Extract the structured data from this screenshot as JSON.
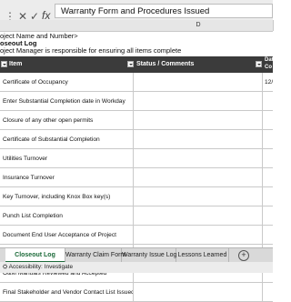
{
  "formula_bar": {
    "cancel_symbol": "✕",
    "confirm_symbol": "✓",
    "fx_label": "fx",
    "content": "Warranty Form and Procedures Issued"
  },
  "column_headers": {
    "d": "D"
  },
  "header_lines": {
    "project": "oject Name and Number>",
    "log_title": "oseout Log",
    "responsibility": "oject Manager is responsible for ensuring all items complete"
  },
  "table": {
    "col_item": "Item",
    "col_status": "Status / Comments",
    "col_date_partial": "Dat\nCo",
    "rows": [
      {
        "item": "Certificate of Occupancy",
        "date": "12/"
      },
      {
        "item": "Enter Substantial Completion date in Workday",
        "date": ""
      },
      {
        "item": "Closure of any other open permits",
        "date": ""
      },
      {
        "item": "Certificate of Substantial Completion",
        "date": ""
      },
      {
        "item": "Utilities Turnover",
        "date": ""
      },
      {
        "item": "Insurance Turnover",
        "date": ""
      },
      {
        "item": "Key Turnover, including Knox Box key(s)",
        "date": ""
      },
      {
        "item": "Punch List Completion",
        "date": ""
      },
      {
        "item": "Document End User Acceptance of Project",
        "date": ""
      },
      {
        "item": "As-Builts Reviewed and Accepted",
        "date": ""
      },
      {
        "item": "O&M Manuals Reviewed and Accepted",
        "date": ""
      },
      {
        "item": "Final Stakeholder and Vendor Contact List Issued",
        "date": ""
      }
    ]
  },
  "tabs": [
    {
      "label": "Closeout Log",
      "active": true
    },
    {
      "label": "Warranty Claim Form",
      "active": false
    },
    {
      "label": "Warranty Issue Log",
      "active": false
    },
    {
      "label": "Lessons Learned",
      "active": false
    }
  ],
  "add_sheet_symbol": "+",
  "status_bar": {
    "accessibility": "Accessibility: Investigate"
  }
}
